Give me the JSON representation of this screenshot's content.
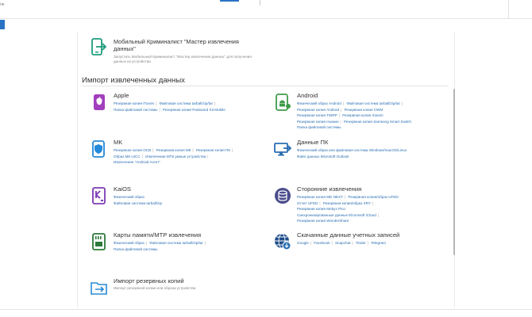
{
  "window": {
    "title_fragment": "rie"
  },
  "wizard": {
    "title": "Мобильный Криминалист \"Мастер извлечения данных\"",
    "description": "Запустить Мобильный Криминалист \"Мастер извлечения данных\" для получения данных из устройства"
  },
  "import_section": {
    "heading": "Импорт извлеченных данных"
  },
  "blocks": {
    "apple": {
      "title": "Apple",
      "links": [
        "Резервная копия iTunes",
        "Файловая система tarball/zip/tar",
        "Папка файловой системы",
        "Резервная копия Password Kit Mobile"
      ]
    },
    "android": {
      "title": "Android",
      "links": [
        "Физический образ Android",
        "Файловая система tarball/zip/tar",
        "Резервная копия Android",
        "Резервная копия CWM",
        "Резервная копия TWRP",
        "Резервная копия Xiaomi",
        "Резервная копия Huawei",
        "Резервная копия Samsung Smart Switch",
        "Папка файловой системы"
      ]
    },
    "mk": {
      "title": "МК",
      "links": [
        "Резервная копия OCB",
        "Резервная копия МК",
        "Резервная копия ПК",
        "Образ МК UICC",
        "Извлечение МТК умные устройства",
        "Извлечение \"Android Агент\""
      ]
    },
    "pc": {
      "title": "Данные ПК",
      "links": [
        "Физический образ или файловая система Windows/macOS/Linux",
        "Файл данных Microsoft Outlook"
      ]
    },
    "kaios": {
      "title": "KaiOS",
      "links": [
        "Физический образ",
        "Файловая система tarball/zip"
      ]
    },
    "third_party": {
      "title": "Сторонние извлечения",
      "links": [
        "Резервная копия MD NEXT",
        "Резервная копия/образ UFED",
        "Отчет UFED",
        "Резервная копия/образ XRY",
        "Резервная копия Mobyx Pico",
        "Синхронизированные данные Elcomsoft iCloud",
        "Резервная копия WonderShare"
      ]
    },
    "memory": {
      "title": "Карты памяти/МТР извлечения",
      "links": [
        "Физический образ",
        "Файловая система tarball/zip/tar",
        "Папка файловой системы"
      ]
    },
    "accounts": {
      "title": "Скачанные данные учетных записей",
      "links": [
        "Google",
        "Facebook",
        "Snapchat",
        "Tinder",
        "Telegram"
      ]
    },
    "backup_import": {
      "title": "Импорт резервных копий",
      "description": "Импорт резервной копии или образа устройства"
    }
  },
  "colors": {
    "wizard_icon": "#1e9c7c",
    "apple_icon": "#a23fbd",
    "android_icon": "#3f9c4a",
    "mk_icon": "#2489d8",
    "pc_icon": "#2a6fb3",
    "kaios_icon": "#7c3bb4",
    "third_party_icon": "#4a4d8c",
    "memory_icon": "#2d7a3c",
    "accounts_icon": "#1e4d8a",
    "backup_icon": "#2a8bd6",
    "link": "#2a6fb3"
  }
}
